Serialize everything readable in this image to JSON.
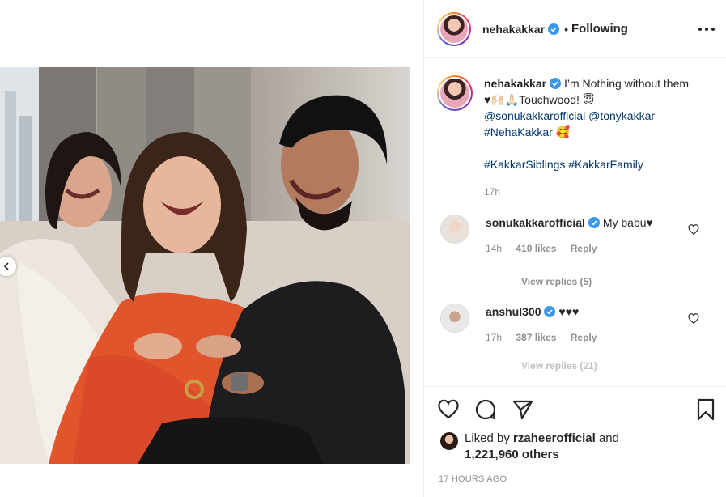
{
  "post": {
    "username": "nehakakkar",
    "follow_status": "Following",
    "dot": "•",
    "caption": {
      "text": "I’m Nothing without them ♥🙌🏻🙏🏻Touchwood! 😇",
      "mentions": [
        "@sonukakkarofficial",
        "@tonykakkar"
      ],
      "tag_line": "#NehaKakkar 🥰",
      "hashtags": "#KakkarSiblings #KakkarFamily",
      "time": "17h"
    },
    "comments": [
      {
        "username": "sonukakkarofficial",
        "text": "My babu♥",
        "time": "14h",
        "likes": "410 likes",
        "reply": "Reply",
        "view_replies": "View replies (5)"
      },
      {
        "username": "anshul300",
        "text": "♥♥♥",
        "time": "17h",
        "likes": "387 likes",
        "reply": "Reply",
        "view_replies": "View replies (21)"
      }
    ],
    "liked_by_prefix": "Liked by",
    "liked_by_user": "rzaheerofficial",
    "liked_by_and": "and",
    "liked_by_count": "1,221,960 others",
    "post_time": "17 HOURS AGO"
  },
  "icons": [
    "heart-icon",
    "comment-icon",
    "share-icon",
    "bookmark-icon",
    "more-icon",
    "verified-icon",
    "chevron-left-icon"
  ],
  "colors": {
    "link": "#00376b",
    "muted": "#8e8e8e",
    "verified": "#3897f0",
    "text": "#262626"
  }
}
